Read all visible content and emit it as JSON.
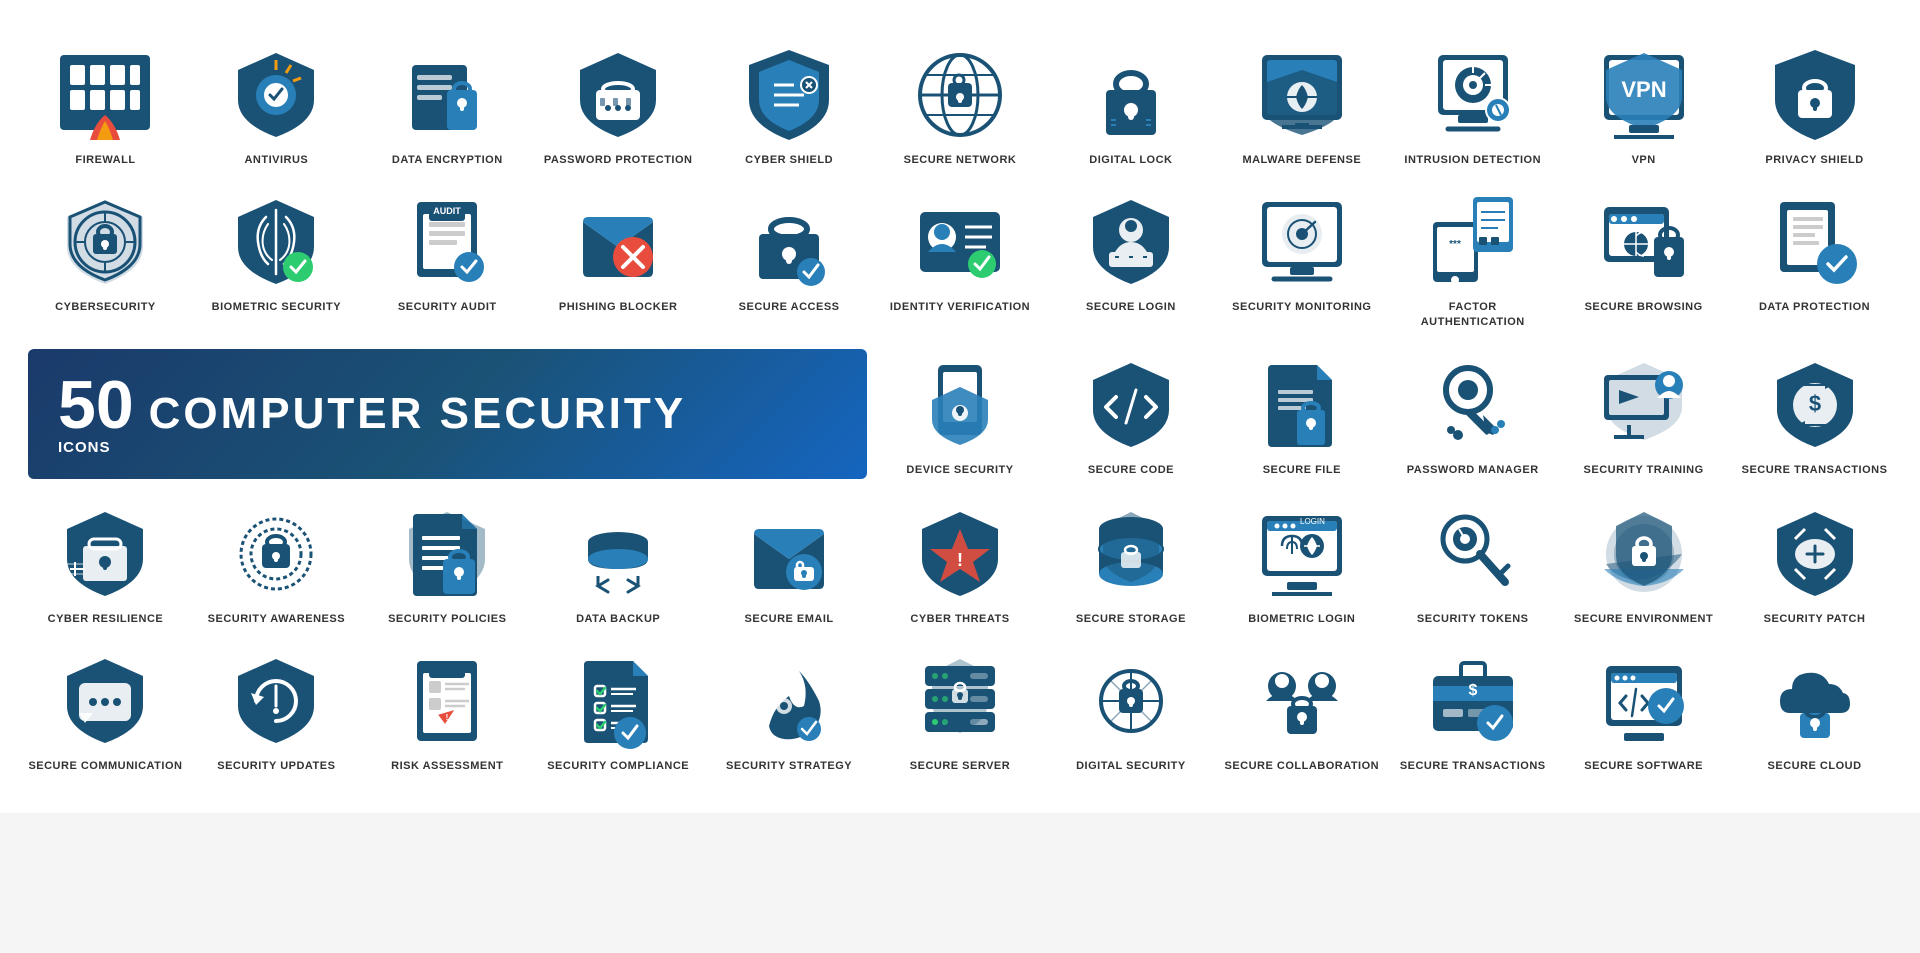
{
  "banner": {
    "number": "50",
    "icons_label": "ICONS",
    "title": "COMPUTER SECURITY"
  },
  "rows": [
    {
      "items": [
        {
          "label": "FIREWALL",
          "id": "firewall"
        },
        {
          "label": "ANTIVIRUS",
          "id": "antivirus"
        },
        {
          "label": "DATA ENCRYPTION",
          "id": "data-encryption"
        },
        {
          "label": "PASSWORD PROTECTION",
          "id": "password-protection"
        },
        {
          "label": "CYBER SHIELD",
          "id": "cyber-shield"
        },
        {
          "label": "SECURE NETWORK",
          "id": "secure-network"
        },
        {
          "label": "DIGITAL LOCK",
          "id": "digital-lock"
        },
        {
          "label": "MALWARE DEFENSE",
          "id": "malware-defense"
        },
        {
          "label": "INTRUSION DETECTION",
          "id": "intrusion-detection"
        },
        {
          "label": "VPN",
          "id": "vpn"
        },
        {
          "label": "PRIVACY SHIELD",
          "id": "privacy-shield"
        }
      ]
    },
    {
      "items": [
        {
          "label": "CYBERSECURITY",
          "id": "cybersecurity"
        },
        {
          "label": "BIOMETRIC SECURITY",
          "id": "biometric-security"
        },
        {
          "label": "SECURITY AUDIT",
          "id": "security-audit"
        },
        {
          "label": "PHISHING BLOCKER",
          "id": "phishing-blocker"
        },
        {
          "label": "SECURE ACCESS",
          "id": "secure-access"
        },
        {
          "label": "IDENTITY VERIFICATION",
          "id": "identity-verification"
        },
        {
          "label": "SECURE LOGIN",
          "id": "secure-login"
        },
        {
          "label": "SECURITY MONITORING",
          "id": "security-monitoring"
        },
        {
          "label": "FACTOR AUTHENTICATION",
          "id": "factor-authentication"
        },
        {
          "label": "SECURE BROWSING",
          "id": "secure-browsing"
        },
        {
          "label": "DATA PROTECTION",
          "id": "data-protection"
        }
      ]
    },
    {
      "banner": true,
      "items": [
        {
          "label": "DEVICE SECURITY",
          "id": "device-security"
        },
        {
          "label": "SECURE CODE",
          "id": "secure-code"
        },
        {
          "label": "SECURE FILE",
          "id": "secure-file"
        },
        {
          "label": "PASSWORD MANAGER",
          "id": "password-manager"
        },
        {
          "label": "SECURITY TRAINING",
          "id": "security-training"
        },
        {
          "label": "SECURE TRANSACTIONS",
          "id": "secure-transactions-1"
        }
      ]
    },
    {
      "items": [
        {
          "label": "CYBER RESILIENCE",
          "id": "cyber-resilience"
        },
        {
          "label": "SECURITY AWARENESS",
          "id": "security-awareness"
        },
        {
          "label": "SECURITY POLICIES",
          "id": "security-policies"
        },
        {
          "label": "DATA BACKUP",
          "id": "data-backup"
        },
        {
          "label": "SECURE EMAIL",
          "id": "secure-email"
        },
        {
          "label": "CYBER THREATS",
          "id": "cyber-threats"
        },
        {
          "label": "SECURE STORAGE",
          "id": "secure-storage"
        },
        {
          "label": "BIOMETRIC LOGIN",
          "id": "biometric-login"
        },
        {
          "label": "SECURITY TOKENS",
          "id": "security-tokens"
        },
        {
          "label": "SECURE ENVIRONMENT",
          "id": "secure-environment"
        },
        {
          "label": "SECURITY PATCH",
          "id": "security-patch"
        }
      ]
    },
    {
      "items": [
        {
          "label": "SECURE COMMUNICATION",
          "id": "secure-communication"
        },
        {
          "label": "SECURITY UPDATES",
          "id": "security-updates"
        },
        {
          "label": "RISK ASSESSMENT",
          "id": "risk-assessment"
        },
        {
          "label": "SECURITY COMPLIANCE",
          "id": "security-compliance"
        },
        {
          "label": "SECURITY STRATEGY",
          "id": "security-strategy"
        },
        {
          "label": "SECURE SERVER",
          "id": "secure-server"
        },
        {
          "label": "DIGITAL SECURITY",
          "id": "digital-security"
        },
        {
          "label": "SECURE COLLABORATION",
          "id": "secure-collaboration"
        },
        {
          "label": "SECURE TRANSACTIONS",
          "id": "secure-transactions-2"
        },
        {
          "label": "SECURE SOFTWARE",
          "id": "secure-software"
        },
        {
          "label": "SECURE CLOUD",
          "id": "secure-cloud"
        }
      ]
    }
  ]
}
